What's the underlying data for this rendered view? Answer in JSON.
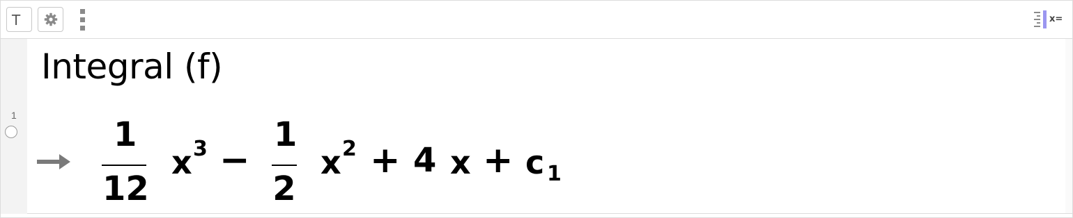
{
  "toolbar": {
    "text_tool_label": "T",
    "settings_icon": "gear-icon",
    "menu_icon": "vertical-dots-icon",
    "toggle_icon": "algebra-description-toggle-icon",
    "toggle_label": "x="
  },
  "algebra": {
    "row_number": "1",
    "input": "Integral (f)",
    "output": {
      "frac1_num": "1",
      "frac1_den": "12",
      "var1": "x",
      "exp1": "3",
      "op1": "−",
      "frac2_num": "1",
      "frac2_den": "2",
      "var2": "x",
      "exp2": "2",
      "op2": "+",
      "coef3": "4",
      "var3": "x",
      "op3": "+",
      "const": "c",
      "const_sub": "1"
    }
  },
  "colors": {
    "accent": "#9b96f0",
    "border": "#dcdcdc",
    "gutter": "#f3f3f3"
  }
}
